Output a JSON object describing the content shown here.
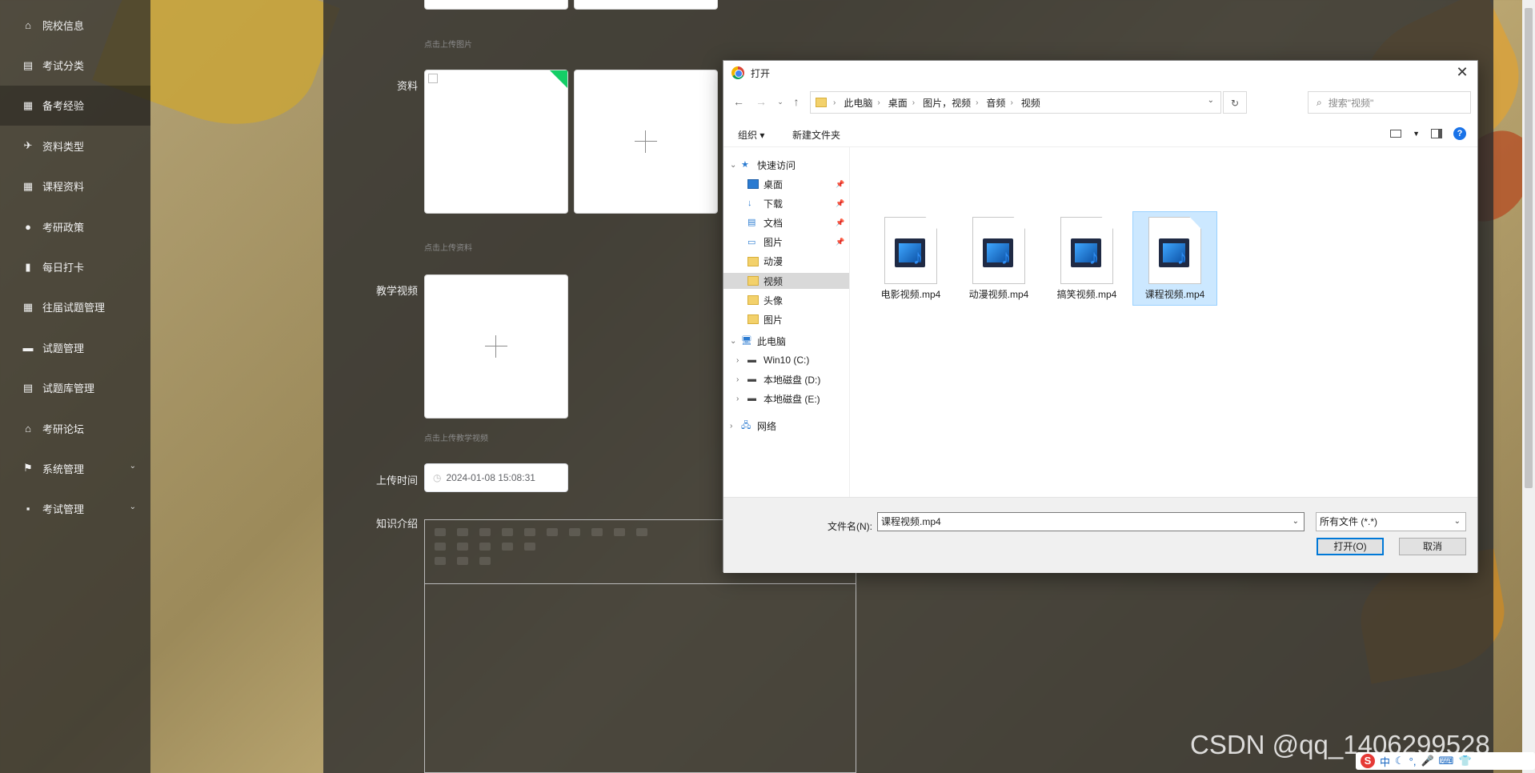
{
  "sidebar": {
    "items": [
      {
        "label": "院校信息",
        "icon": "house-icon"
      },
      {
        "label": "考试分类",
        "icon": "clipboard-icon"
      },
      {
        "label": "备考经验",
        "icon": "grid-icon",
        "active": true
      },
      {
        "label": "资料类型",
        "icon": "paper-plane-icon"
      },
      {
        "label": "课程资料",
        "icon": "grid-icon"
      },
      {
        "label": "考研政策",
        "icon": "user-icon"
      },
      {
        "label": "每日打卡",
        "icon": "bar-chart-icon"
      },
      {
        "label": "往届试题管理",
        "icon": "grid-icon"
      },
      {
        "label": "试题管理",
        "icon": "monitor-icon"
      },
      {
        "label": "试题库管理",
        "icon": "clipboard-icon"
      },
      {
        "label": "考研论坛",
        "icon": "bank-icon"
      },
      {
        "label": "系统管理",
        "icon": "flag-icon",
        "expandable": true
      },
      {
        "label": "考试管理",
        "icon": "chat-icon",
        "expandable": true
      }
    ]
  },
  "form": {
    "image_hint": "点击上传图片",
    "material_label": "资料",
    "material_hint": "点击上传资料",
    "video_label": "教学视频",
    "video_hint": "点击上传教学视频",
    "upload_time_label": "上传时间",
    "upload_time_value": "2024-01-08 15:08:31",
    "intro_label": "知识介绍"
  },
  "dialog": {
    "title": "打开",
    "breadcrumbs": [
      "此电脑",
      "桌面",
      "图片，视频",
      "音频",
      "视频"
    ],
    "search_placeholder": "搜索\"视频\"",
    "organize_label": "组织 ▾",
    "new_folder_label": "新建文件夹",
    "tree": {
      "quick_access": "快速访问",
      "quick_items": [
        "桌面",
        "下载",
        "文档",
        "图片",
        "动漫",
        "视频",
        "头像",
        "图片"
      ],
      "this_pc": "此电脑",
      "drives": [
        "Win10 (C:)",
        "本地磁盘 (D:)",
        "本地磁盘 (E:)"
      ],
      "network": "网络"
    },
    "files": [
      "电影视频.mp4",
      "动漫视频.mp4",
      "搞笑视频.mp4",
      "课程视频.mp4"
    ],
    "selected_file_index": 3,
    "filename_label": "文件名(N):",
    "filename_value": "课程视频.mp4",
    "filetype_value": "所有文件 (*.*)",
    "open_label": "打开(O)",
    "cancel_label": "取消"
  },
  "watermark": "CSDN @qq_1406299528",
  "tray": {
    "ime": "中"
  }
}
